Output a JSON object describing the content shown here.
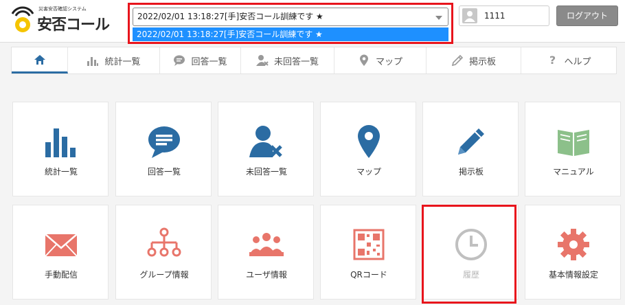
{
  "header": {
    "logo_subtitle": "災害安否確認システム",
    "logo_title": "安否コール",
    "select_value": "2022/02/01 13:18:27[手]安否コール訓練です ★",
    "dropdown_option": "2022/02/01 13:18:27[手]安否コール訓練です ★",
    "user_id": "1111",
    "logout_label": "ログアウト"
  },
  "nav": {
    "items": [
      {
        "label": ""
      },
      {
        "label": "統計一覧"
      },
      {
        "label": "回答一覧"
      },
      {
        "label": "未回答一覧"
      },
      {
        "label": "マップ"
      },
      {
        "label": "掲示板"
      },
      {
        "label": "ヘルプ"
      }
    ]
  },
  "tiles": [
    {
      "label": "統計一覧",
      "icon": "bar-chart-icon"
    },
    {
      "label": "回答一覧",
      "icon": "speech-bubble-icon"
    },
    {
      "label": "未回答一覧",
      "icon": "user-x-icon"
    },
    {
      "label": "マップ",
      "icon": "map-pin-icon"
    },
    {
      "label": "掲示板",
      "icon": "pencil-icon"
    },
    {
      "label": "マニュアル",
      "icon": "book-icon"
    },
    {
      "label": "手動配信",
      "icon": "envelope-icon"
    },
    {
      "label": "グループ情報",
      "icon": "org-chart-icon"
    },
    {
      "label": "ユーザ情報",
      "icon": "users-icon"
    },
    {
      "label": "QRコード",
      "icon": "qr-code-icon"
    },
    {
      "label": "履歴",
      "icon": "clock-icon"
    },
    {
      "label": "基本情報設定",
      "icon": "gear-icon"
    }
  ],
  "colors": {
    "blue": "#2b6ca3",
    "green": "#8cc08a",
    "red": "#e8756a",
    "gray": "#c0c0c0",
    "highlight": "#e8141c"
  }
}
